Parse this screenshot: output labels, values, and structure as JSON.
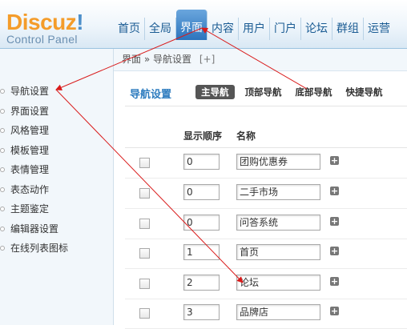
{
  "logo": {
    "name_part1": "Discuz",
    "name_part2": "!",
    "subtitle": "Control Panel"
  },
  "nav": {
    "items": [
      {
        "label": "首页",
        "active": false
      },
      {
        "label": "全局",
        "active": false
      },
      {
        "label": "界面",
        "active": true
      },
      {
        "label": "内容",
        "active": false
      },
      {
        "label": "用户",
        "active": false
      },
      {
        "label": "门户",
        "active": false
      },
      {
        "label": "论坛",
        "active": false
      },
      {
        "label": "群组",
        "active": false
      },
      {
        "label": "运营",
        "active": false
      }
    ]
  },
  "breadcrumb": {
    "parent": "界面",
    "separator": "»",
    "current": "导航设置",
    "add": "[+]"
  },
  "sidebar": {
    "items": [
      {
        "label": "导航设置"
      },
      {
        "label": "界面设置"
      },
      {
        "label": "风格管理"
      },
      {
        "label": "模板管理"
      },
      {
        "label": "表情管理"
      },
      {
        "label": "表态动作"
      },
      {
        "label": "主题鉴定"
      },
      {
        "label": "编辑器设置"
      },
      {
        "label": "在线列表图标"
      }
    ]
  },
  "main": {
    "title": "导航设置",
    "tabs": [
      {
        "label": "主导航",
        "active": true
      },
      {
        "label": "顶部导航",
        "active": false
      },
      {
        "label": "底部导航",
        "active": false
      },
      {
        "label": "快捷导航",
        "active": false
      }
    ],
    "table": {
      "headers": {
        "order": "显示顺序",
        "name": "名称"
      },
      "rows": [
        {
          "order": "0",
          "name": "团购优惠券"
        },
        {
          "order": "0",
          "name": "二手市场"
        },
        {
          "order": "0",
          "name": "问答系统"
        },
        {
          "order": "1",
          "name": "首页"
        },
        {
          "order": "2",
          "name": "论坛"
        },
        {
          "order": "3",
          "name": "品牌店"
        }
      ],
      "add_symbol": "+"
    }
  },
  "colors": {
    "accent": "#2d7cbf",
    "annotation": "#d91a1a",
    "logo_orange": "#f49c2a",
    "logo_blue": "#4d8fca"
  }
}
